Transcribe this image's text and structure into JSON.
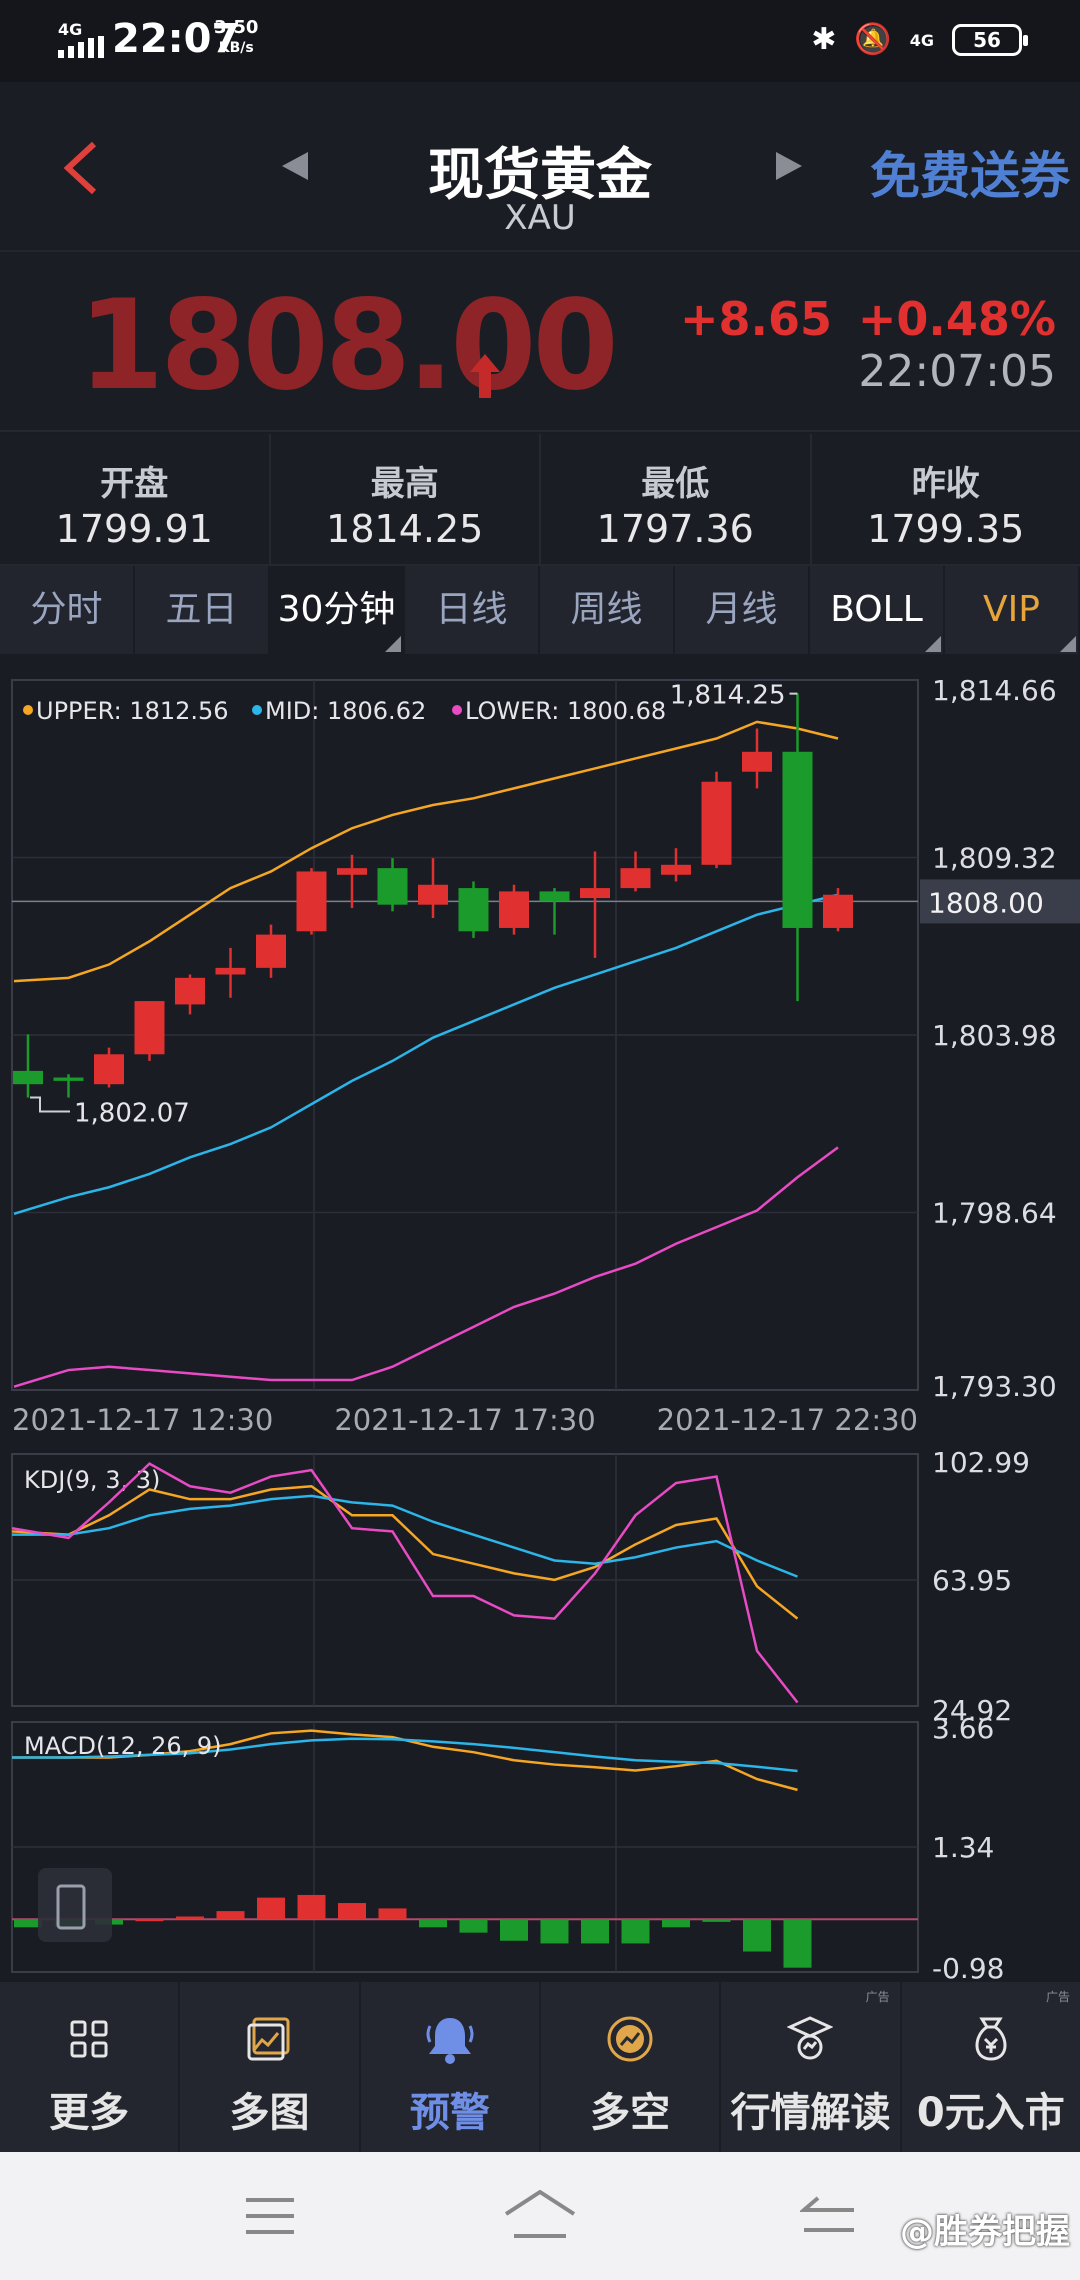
{
  "status": {
    "time": "22:07",
    "signal_label": "4G",
    "net_speed_value": "3.50",
    "net_speed_unit": "KB/s",
    "right_signal": "4G",
    "battery": "56"
  },
  "header": {
    "title": "现货黄金",
    "symbol": "XAU",
    "coupon": "免费送券"
  },
  "quote": {
    "price": "1808.00",
    "change": "+8.65",
    "change_pct": "+0.48%",
    "time": "22:07:05",
    "up_color": "#e0302f"
  },
  "stats": [
    {
      "label": "开盘",
      "value": "1799.91"
    },
    {
      "label": "最高",
      "value": "1814.25"
    },
    {
      "label": "最低",
      "value": "1797.36"
    },
    {
      "label": "昨收",
      "value": "1799.35"
    }
  ],
  "tabs": [
    {
      "label": "分时",
      "active": false
    },
    {
      "label": "五日",
      "active": false
    },
    {
      "label": "30分钟",
      "active": true
    },
    {
      "label": "日线",
      "active": false
    },
    {
      "label": "周线",
      "active": false
    },
    {
      "label": "月线",
      "active": false
    },
    {
      "label": "BOLL",
      "active": false
    },
    {
      "label": "VIP",
      "active": false
    }
  ],
  "chart_data": [
    {
      "type": "candlestick",
      "title": "",
      "legend": [
        {
          "name": "UPPER",
          "label": "UPPER: 1812.56",
          "color": "#f5a623"
        },
        {
          "name": "MID",
          "label": "MID: 1806.62",
          "color": "#2bb5e8"
        },
        {
          "name": "LOWER",
          "label": "LOWER: 1800.68",
          "color": "#e84bc4"
        }
      ],
      "ylim": [
        1793.3,
        1814.66
      ],
      "ytick_labels": [
        "1,814.66",
        "1,809.32",
        "1,803.98",
        "1,798.64",
        "1,793.30"
      ],
      "xtick_labels": [
        "2021-12-17 12:30",
        "2021-12-17 17:30",
        "2021-12-17 22:30"
      ],
      "current_price_label": "1808.00",
      "max_label": "1,814.25",
      "min_label": "1,802.07",
      "candles": [
        {
          "o": 1802.9,
          "h": 1804.0,
          "l": 1802.1,
          "c": 1802.5
        },
        {
          "o": 1802.7,
          "h": 1802.8,
          "l": 1802.1,
          "c": 1802.6
        },
        {
          "o": 1802.5,
          "h": 1803.6,
          "l": 1802.4,
          "c": 1803.4
        },
        {
          "o": 1803.4,
          "h": 1805.0,
          "l": 1803.2,
          "c": 1805.0
        },
        {
          "o": 1804.9,
          "h": 1805.8,
          "l": 1804.6,
          "c": 1805.7
        },
        {
          "o": 1805.8,
          "h": 1806.6,
          "l": 1805.1,
          "c": 1806.0
        },
        {
          "o": 1806.0,
          "h": 1807.3,
          "l": 1805.7,
          "c": 1807.0
        },
        {
          "o": 1807.1,
          "h": 1809.0,
          "l": 1807.0,
          "c": 1808.9
        },
        {
          "o": 1808.8,
          "h": 1809.4,
          "l": 1807.8,
          "c": 1809.0
        },
        {
          "o": 1809.0,
          "h": 1809.3,
          "l": 1807.7,
          "c": 1807.9
        },
        {
          "o": 1807.9,
          "h": 1809.3,
          "l": 1807.5,
          "c": 1808.5
        },
        {
          "o": 1808.4,
          "h": 1808.6,
          "l": 1806.9,
          "c": 1807.1
        },
        {
          "o": 1807.2,
          "h": 1808.5,
          "l": 1807.0,
          "c": 1808.3
        },
        {
          "o": 1808.3,
          "h": 1808.4,
          "l": 1807.0,
          "c": 1808.0
        },
        {
          "o": 1808.1,
          "h": 1809.5,
          "l": 1806.3,
          "c": 1808.4
        },
        {
          "o": 1808.4,
          "h": 1809.5,
          "l": 1808.3,
          "c": 1809.0
        },
        {
          "o": 1808.8,
          "h": 1809.6,
          "l": 1808.6,
          "c": 1809.1
        },
        {
          "o": 1809.1,
          "h": 1811.9,
          "l": 1809.0,
          "c": 1811.6
        },
        {
          "o": 1811.9,
          "h": 1813.2,
          "l": 1811.4,
          "c": 1812.5
        },
        {
          "o": 1812.5,
          "h": 1814.25,
          "l": 1805.0,
          "c": 1807.2
        },
        {
          "o": 1807.2,
          "h": 1808.4,
          "l": 1807.1,
          "c": 1808.2
        }
      ],
      "upper": [
        1805.6,
        1805.7,
        1806.1,
        1806.8,
        1807.6,
        1808.4,
        1808.9,
        1809.6,
        1810.2,
        1810.6,
        1810.9,
        1811.1,
        1811.4,
        1811.7,
        1812.0,
        1812.3,
        1812.6,
        1812.9,
        1813.4,
        1813.2,
        1812.9
      ],
      "mid": [
        1798.6,
        1799.1,
        1799.4,
        1799.8,
        1800.3,
        1800.7,
        1801.2,
        1801.9,
        1802.6,
        1803.2,
        1803.9,
        1804.4,
        1804.9,
        1805.4,
        1805.8,
        1806.2,
        1806.6,
        1807.1,
        1807.6,
        1807.9,
        1808.2
      ],
      "lower": [
        1793.4,
        1793.9,
        1794.0,
        1793.9,
        1793.8,
        1793.7,
        1793.6,
        1793.6,
        1793.6,
        1794.0,
        1794.6,
        1795.2,
        1795.8,
        1796.2,
        1796.7,
        1797.1,
        1797.7,
        1798.2,
        1798.7,
        1799.7,
        1800.6
      ]
    },
    {
      "type": "line",
      "title": "KDJ(9, 3, 3)",
      "ylim": [
        24.92,
        102.99
      ],
      "ytick_labels": [
        "102.99",
        "63.95",
        "24.92"
      ],
      "series": [
        {
          "name": "K",
          "color": "#f5a623",
          "values": [
            79,
            78,
            84,
            92,
            89,
            89,
            92,
            93,
            84,
            84,
            72,
            69,
            66,
            64,
            68,
            75,
            81,
            83,
            62,
            52
          ]
        },
        {
          "name": "D",
          "color": "#2bb5e8",
          "values": [
            78,
            78,
            80,
            84,
            86,
            87,
            89,
            90,
            88,
            87,
            82,
            78,
            74,
            70,
            69,
            71,
            74,
            76,
            70,
            65
          ]
        },
        {
          "name": "J",
          "color": "#e84bc4",
          "values": [
            80,
            77,
            88,
            100,
            93,
            91,
            96,
            98,
            80,
            79,
            59,
            59,
            53,
            52,
            66,
            84,
            94,
            96,
            42,
            26
          ]
        }
      ]
    },
    {
      "type": "bar+line",
      "title": "MACD(12, 26, 9)",
      "ylim": [
        -0.98,
        3.66
      ],
      "ytick_labels": [
        "3.66",
        "1.34",
        "-0.98"
      ],
      "series": [
        {
          "name": "DIF",
          "color": "#f5a623",
          "values": [
            3.0,
            3.0,
            3.0,
            3.05,
            3.12,
            3.25,
            3.45,
            3.5,
            3.43,
            3.38,
            3.2,
            3.1,
            2.95,
            2.87,
            2.82,
            2.76,
            2.84,
            2.94,
            2.6,
            2.4
          ]
        },
        {
          "name": "DEA",
          "color": "#2bb5e8",
          "values": [
            3.0,
            3.0,
            3.02,
            3.05,
            3.08,
            3.15,
            3.25,
            3.32,
            3.35,
            3.34,
            3.3,
            3.25,
            3.18,
            3.1,
            3.02,
            2.95,
            2.92,
            2.9,
            2.83,
            2.75
          ]
        },
        {
          "name": "MACD",
          "values": [
            -0.15,
            -0.15,
            -0.1,
            0.0,
            0.05,
            0.15,
            0.4,
            0.45,
            0.3,
            0.2,
            -0.15,
            -0.25,
            -0.4,
            -0.45,
            -0.45,
            -0.45,
            -0.15,
            -0.05,
            -0.6,
            -0.9
          ]
        }
      ]
    }
  ],
  "toolbar": [
    {
      "label": "更多",
      "icon": "grid-icon",
      "active": false
    },
    {
      "label": "多图",
      "icon": "multi-chart-icon",
      "active": false
    },
    {
      "label": "预警",
      "icon": "bell-icon",
      "active": true
    },
    {
      "label": "多空",
      "icon": "long-short-icon",
      "active": false
    },
    {
      "label": "行情解读",
      "icon": "analysis-icon",
      "active": false,
      "ad": "广告"
    },
    {
      "label": "0元入市",
      "icon": "money-bag-icon",
      "active": false,
      "ad": "广告"
    }
  ],
  "watermark": "@胜券把握",
  "colors": {
    "up": "#e0302f",
    "down": "#1a9b2b"
  }
}
